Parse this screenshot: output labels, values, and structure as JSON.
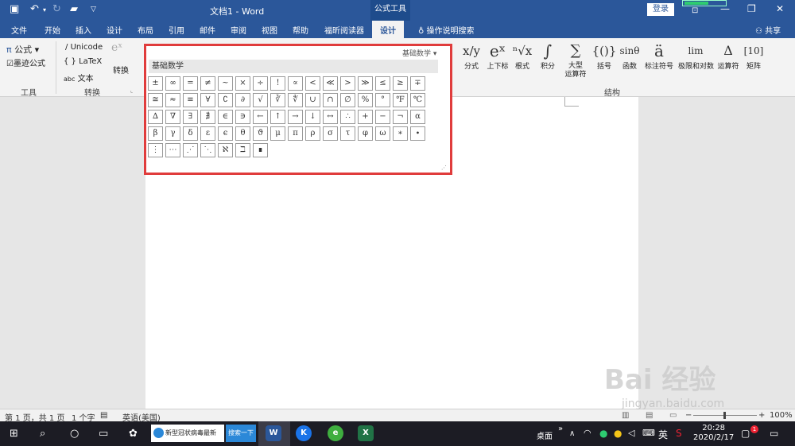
{
  "titlebar": {
    "doc_title": "文档1  -  Word",
    "context_label": "公式工具",
    "login": "登录"
  },
  "tabs": [
    "文件",
    "开始",
    "插入",
    "设计",
    "布局",
    "引用",
    "邮件",
    "审阅",
    "视图",
    "帮助",
    "福昕阅读器"
  ],
  "active_tab": "设计",
  "tell_me": "操作说明搜索",
  "share": "共享",
  "ribbon": {
    "tools": {
      "equation": "公式",
      "ink": "墨迹公式",
      "group": "工具"
    },
    "convert": {
      "unicode": "Unicode",
      "latex": "LaTeX",
      "text": "文本",
      "convert_btn": "转换",
      "group": "转换"
    },
    "structures": {
      "group": "结构",
      "items": [
        {
          "symbol": "x/y",
          "label": "分式"
        },
        {
          "symbol": "eˣ",
          "label": "上下标"
        },
        {
          "symbol": "ⁿ√x",
          "label": "根式"
        },
        {
          "symbol": "∫",
          "label": "积分"
        },
        {
          "symbol": "∑",
          "label": "大型\n运算符"
        },
        {
          "symbol": "{()}",
          "label": "括号"
        },
        {
          "symbol": "sinθ",
          "label": "函数"
        },
        {
          "symbol": "ä",
          "label": "标注符号"
        },
        {
          "symbol": "lim",
          "label": "极限和对数"
        },
        {
          "symbol": "Δ",
          "label": "运算符"
        },
        {
          "symbol": "[10]",
          "label": "矩阵"
        }
      ]
    }
  },
  "gallery": {
    "dropdown": "基础数学",
    "heading": "基础数学",
    "symbols": [
      "±",
      "∞",
      "=",
      "≠",
      "~",
      "×",
      "÷",
      "!",
      "∝",
      "<",
      "≪",
      ">",
      "≫",
      "≤",
      "≥",
      "∓",
      "≅",
      "≈",
      "≡",
      "∀",
      "∁",
      "∂",
      "√",
      "∛",
      "∜",
      "∪",
      "∩",
      "∅",
      "%",
      "°",
      "℉",
      "℃",
      "∆",
      "∇",
      "∃",
      "∄",
      "∈",
      "∋",
      "←",
      "↑",
      "→",
      "↓",
      "↔",
      "∴",
      "+",
      "−",
      "¬",
      "α",
      "β",
      "γ",
      "δ",
      "ε",
      "ϵ",
      "θ",
      "ϑ",
      "μ",
      "π",
      "ρ",
      "σ",
      "τ",
      "φ",
      "ω",
      "∗",
      "∙",
      "⋮",
      "⋯",
      "⋰",
      "⋱",
      "ℵ",
      "ℶ",
      "∎"
    ]
  },
  "status": {
    "page": "第 1 页，共 1 页",
    "words": "1 个字",
    "lang": "英语(美国)",
    "zoom": "100%",
    "zoom_minus": "−",
    "zoom_plus": "+"
  },
  "taskbar": {
    "edge_text": "新型冠状病毒最新",
    "search_btn": "搜索一下",
    "desktop": "桌面",
    "ime": "英",
    "time": "20:28",
    "date": "2020/2/17",
    "notif_count": "1"
  },
  "watermark": {
    "main": "Bai 经验",
    "url": "jingyan.baidu.com"
  }
}
